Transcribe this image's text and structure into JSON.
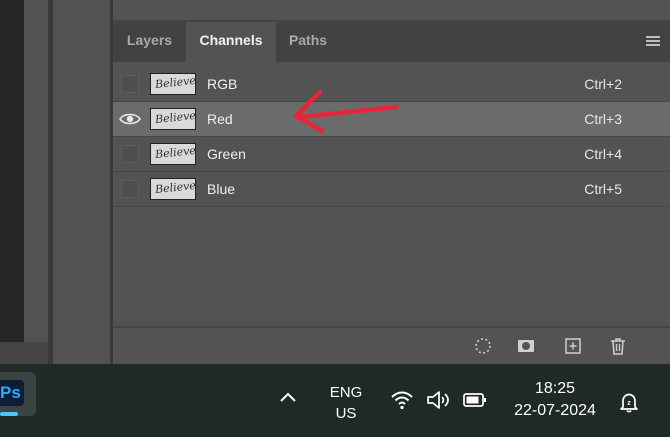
{
  "panel": {
    "tabs": [
      {
        "label": "Layers"
      },
      {
        "label": "Channels"
      },
      {
        "label": "Paths"
      }
    ],
    "active_tab": "Channels",
    "channels": [
      {
        "name": "RGB",
        "shortcut": "Ctrl+2",
        "visible": false,
        "selected": false
      },
      {
        "name": "Red",
        "shortcut": "Ctrl+3",
        "visible": true,
        "selected": true
      },
      {
        "name": "Green",
        "shortcut": "Ctrl+4",
        "visible": false,
        "selected": false
      },
      {
        "name": "Blue",
        "shortcut": "Ctrl+5",
        "visible": false,
        "selected": false
      }
    ],
    "thumbnail_text": "Believe"
  },
  "taskbar": {
    "app_label": "Ps",
    "language": {
      "line1": "ENG",
      "line2": "US"
    },
    "time": "18:25",
    "date": "22-07-2024"
  },
  "icons": {
    "eye": "eye-icon",
    "menu": "panel-menu-icon",
    "load_selection": "dotted-circle-icon",
    "save_mask": "mask-icon",
    "new_channel": "plus-square-icon",
    "delete": "trash-icon",
    "wifi": "wifi-icon",
    "volume": "speaker-icon",
    "battery": "battery-icon",
    "notifications": "bell-icon"
  },
  "colors": {
    "annotation_arrow": "#e8243b",
    "ps_accent": "#31a8ff",
    "selected_row": "#6b6b6b"
  }
}
